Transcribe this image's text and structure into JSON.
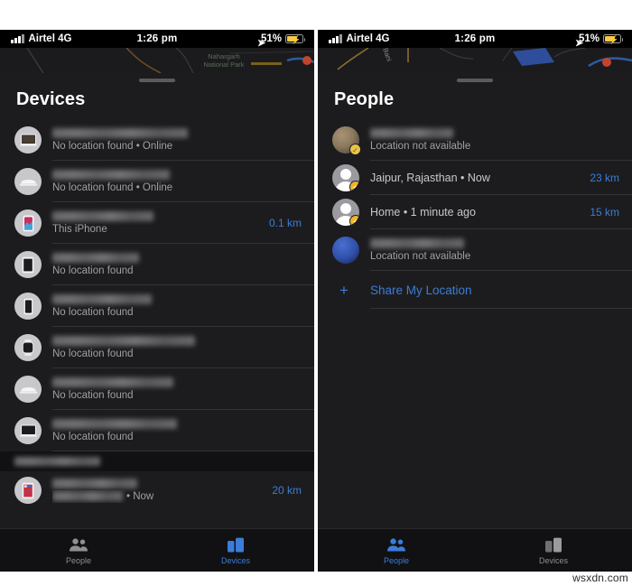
{
  "status_bar": {
    "carrier": "Airtel 4G",
    "time": "1:26 pm",
    "battery_percent": "51%",
    "location_arrow_icon": "location-arrow-icon",
    "signal_icon": "cellular-signal-icon",
    "battery_icon": "battery-charging-icon"
  },
  "colors": {
    "accent_blue": "#3b7dd8",
    "sheet_background": "#1c1c1e",
    "tabbar_background": "#111113",
    "subtitle_gray": "#a0a0a5",
    "separator": "#333336"
  },
  "map": {
    "left_label_line1": "Nahargarh",
    "left_label_line2": "National Park",
    "right_label": "Bani"
  },
  "left_panel": {
    "title": "Devices",
    "grabber": "sheet-grabber",
    "items": [
      {
        "icon": "macbook-pro-icon",
        "name_redacted": true,
        "name_width": 150,
        "subtitle": "No location found • Online",
        "distance": ""
      },
      {
        "icon": "mac-mini-icon",
        "name_redacted": true,
        "name_width": 130,
        "subtitle": "No location found • Online",
        "distance": ""
      },
      {
        "icon": "iphone-icon",
        "name_redacted": true,
        "name_width": 112,
        "subtitle": "This iPhone",
        "distance": "0.1 km"
      },
      {
        "icon": "ipad-icon",
        "name_redacted": true,
        "name_width": 96,
        "subtitle": "No location found",
        "distance": ""
      },
      {
        "icon": "iphone-alt-icon",
        "name_redacted": true,
        "name_width": 110,
        "subtitle": "No location found",
        "distance": ""
      },
      {
        "icon": "apple-watch-icon",
        "name_redacted": true,
        "name_width": 158,
        "subtitle": "No location found",
        "distance": ""
      },
      {
        "icon": "mac-mini-alt-icon",
        "name_redacted": true,
        "name_width": 134,
        "subtitle": "No location found",
        "distance": ""
      },
      {
        "icon": "macbook-icon",
        "name_redacted": true,
        "name_width": 138,
        "subtitle": "No location found",
        "distance": ""
      }
    ],
    "group_header_redacted": true,
    "group_items": [
      {
        "icon": "ipad-red-icon",
        "name_redacted": true,
        "name_width": 94,
        "subtitle": "• Now",
        "subtitle_redacted": true,
        "distance": "20 km"
      }
    ],
    "tabs": [
      {
        "label": "People",
        "icon": "people-icon",
        "active": false
      },
      {
        "label": "Devices",
        "icon": "devices-icon",
        "active": true
      }
    ]
  },
  "right_panel": {
    "title": "People",
    "grabber": "sheet-grabber",
    "items": [
      {
        "avatar": "photo-avatar-tan",
        "badge": "check-badge",
        "name_redacted": true,
        "name_width": 92,
        "subtitle": "Location not available",
        "distance": ""
      },
      {
        "avatar": "person-placeholder-avatar",
        "badge": "star-badge",
        "name_redacted": false,
        "name_hidden": true,
        "subtitle": "Jaipur, Rajasthan • Now",
        "distance": "23 km"
      },
      {
        "avatar": "person-placeholder-avatar",
        "badge": "star-badge",
        "name_redacted": false,
        "name_hidden": true,
        "subtitle": "Home • 1 minute ago",
        "distance": "15 km"
      },
      {
        "avatar": "photo-avatar-blue",
        "badge": "none",
        "name_redacted": true,
        "name_width": 104,
        "subtitle": "Location not available",
        "distance": ""
      }
    ],
    "share": {
      "label": "Share My Location",
      "icon": "plus-icon"
    },
    "tabs": [
      {
        "label": "People",
        "icon": "people-icon",
        "active": true
      },
      {
        "label": "Devices",
        "icon": "devices-icon",
        "active": false
      }
    ]
  },
  "watermark": "wsxdn.com"
}
